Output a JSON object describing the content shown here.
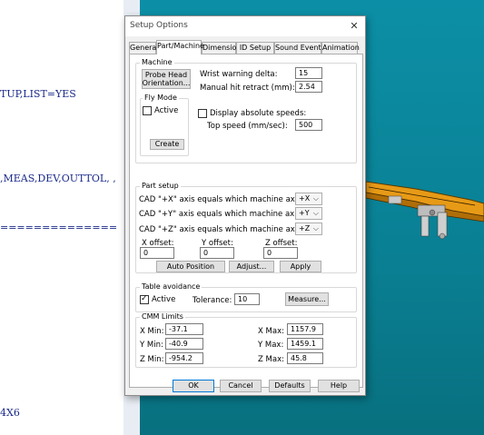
{
  "editor": {
    "line1": "TUP,LIST=YES",
    "line2": ",MEAS,DEV,OUTTOL, ,",
    "line3": "==============",
    "line4": "4X6"
  },
  "dialog": {
    "title": "Setup Options",
    "close_glyph": "✕",
    "tabs": [
      "General",
      "Part/Machine",
      "Dimension",
      "ID Setup",
      "Sound Events",
      "Animation"
    ],
    "active_tab": "Part/Machine",
    "machine": {
      "group_label": "Machine",
      "probe_head_button": "Probe Head\nOrientation...",
      "wrist_warning_label": "Wrist warning delta:",
      "wrist_warning_value": "15",
      "manual_hit_label": "Manual hit retract (mm):",
      "manual_hit_value": "2.54",
      "fly_mode_label": "Fly Mode",
      "active_label": "Active",
      "active_checked": false,
      "display_speeds_label": "Display absolute speeds:",
      "display_speeds_checked": false,
      "top_speed_label": "Top speed (mm/sec):",
      "top_speed_value": "500",
      "create_button": "Create"
    },
    "part_setup": {
      "group_label": "Part setup",
      "cad_x_label": "CAD \"+X\" axis equals which machine axis?",
      "cad_x_value": "+X",
      "cad_y_label": "CAD \"+Y\" axis equals which machine axis?",
      "cad_y_value": "+Y",
      "cad_z_label": "CAD \"+Z\" axis equals which machine axis?",
      "cad_z_value": "+Z",
      "x_offset_label": "X offset:",
      "x_offset_value": "0",
      "y_offset_label": "Y offset:",
      "y_offset_value": "0",
      "z_offset_label": "Z offset:",
      "z_offset_value": "0",
      "auto_position_button": "Auto Position",
      "adjust_button": "Adjust...",
      "apply_button": "Apply"
    },
    "table_avoidance": {
      "group_label": "Table avoidance",
      "active_label": "Active",
      "active_checked": true,
      "tolerance_label": "Tolerance:",
      "tolerance_value": "10",
      "measure_button": "Measure..."
    },
    "cmm_limits": {
      "group_label": "CMM Limits",
      "x_min_label": "X Min:",
      "x_min_value": "-37.1",
      "y_min_label": "Y Min:",
      "y_min_value": "-40.9",
      "z_min_label": "Z Min:",
      "z_min_value": "-954.2",
      "x_max_label": "X Max:",
      "x_max_value": "1157.9",
      "y_max_label": "Y Max:",
      "y_max_value": "1459.1",
      "z_max_label": "Z Max:",
      "z_max_value": "45.8"
    },
    "buttons": {
      "ok": "OK",
      "cancel": "Cancel",
      "defaults": "Defaults",
      "help": "Help"
    }
  },
  "colors": {
    "viewport_bg": "#0c8fa6",
    "part_orange": "#e79a16",
    "accent_blue": "#0078d7",
    "editor_text": "#1a2a8a"
  }
}
